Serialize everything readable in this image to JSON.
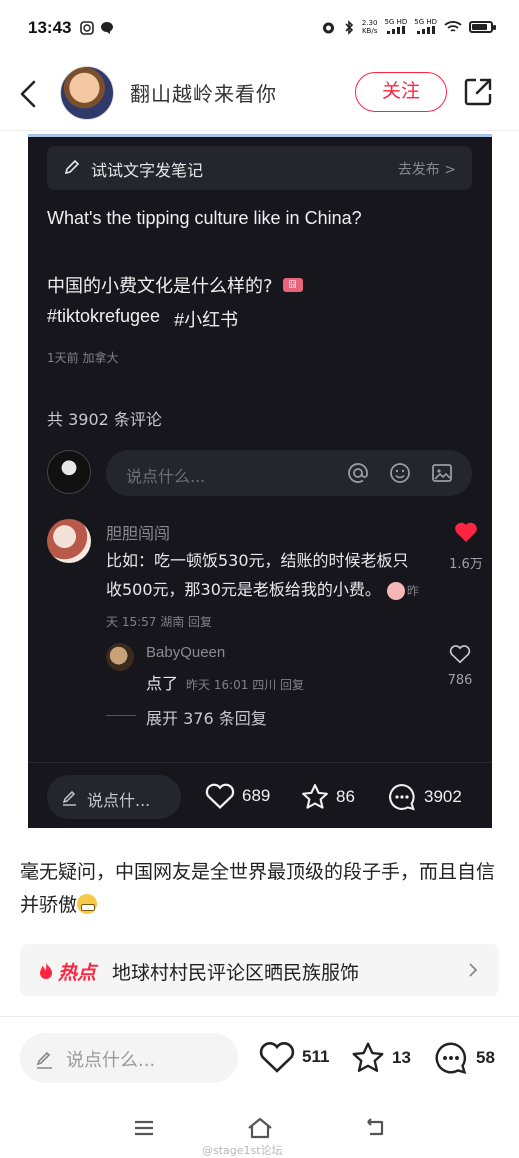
{
  "status_bar": {
    "time": "13:43",
    "network_speed": "2.30",
    "network_unit": "KB/s",
    "signal1_label": "5G HD",
    "signal2_label": "5G HD",
    "battery_level": 0.85
  },
  "header": {
    "author_name": "翻山越岭来看你",
    "follow_label": "关注"
  },
  "embedded_screenshot": {
    "try_bar_text": "试试文字发笔记",
    "try_bar_action": "去发布 >",
    "question_en": "What's the tipping culture like in China?",
    "question_zh": "中国的小费文化是什么样的?",
    "badge_text": "囧",
    "tags": [
      "#tiktokrefugee",
      "#小红书"
    ],
    "meta": "1天前 加拿大",
    "comment_count": "共 3902 条评论",
    "comment_placeholder": "说点什么...",
    "comment": {
      "author": "胆胆闯闯",
      "text": "比如：吃一顿饭530元，结账的时候老板只收500元，那30元是老板给我的小费。",
      "meta": "昨天 15:57 湖南 回复",
      "like_count": "1.6万"
    },
    "reply": {
      "author": "BabyQueen",
      "text": "点了",
      "meta": "昨天 16:01 四川 回复",
      "like_count": "786"
    },
    "expand_label": "展开 376 条回复",
    "bottom_placeholder": "说点什...",
    "likes": "689",
    "stars": "86",
    "comments": "3902"
  },
  "post": {
    "text": "毫无疑问，中国网友是全世界最顶级的段子手，而且自信并骄傲"
  },
  "hot": {
    "label": "热点",
    "topic": "地球村村民评论区晒民族服饰"
  },
  "bottom_bar": {
    "placeholder": "说点什么...",
    "likes": "511",
    "stars": "13",
    "comments": "58"
  },
  "watermark": "@stage1st论坛"
}
